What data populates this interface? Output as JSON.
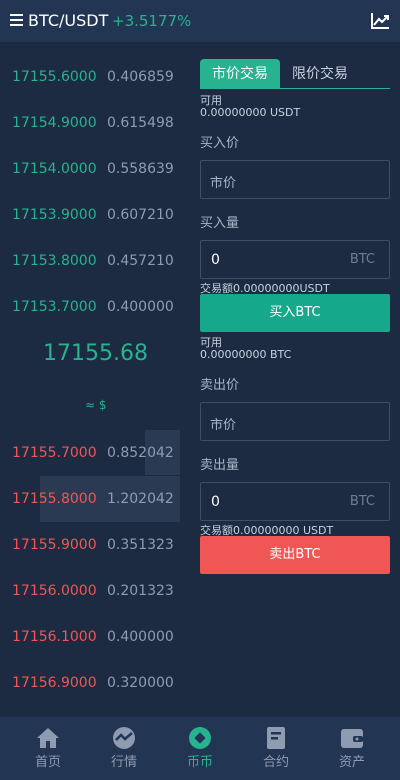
{
  "header": {
    "pair": "BTC/USDT",
    "change": "+3.5177%",
    "menu_icon": "menu-icon",
    "chart_icon": "line-chart-icon"
  },
  "orderbook": {
    "asks_green": [
      {
        "price": "17155.6000",
        "qty": "0.406859"
      },
      {
        "price": "17154.9000",
        "qty": "0.615498"
      },
      {
        "price": "17154.0000",
        "qty": "0.558639"
      },
      {
        "price": "17153.9000",
        "qty": "0.607210"
      },
      {
        "price": "17153.8000",
        "qty": "0.457210"
      },
      {
        "price": "17153.7000",
        "qty": "0.400000"
      }
    ],
    "last_price": "17155.68",
    "approx": "≈ $",
    "bids_red": [
      {
        "price": "17155.7000",
        "qty": "0.852042"
      },
      {
        "price": "17155.8000",
        "qty": "1.202042"
      },
      {
        "price": "17155.9000",
        "qty": "0.351323"
      },
      {
        "price": "17156.0000",
        "qty": "0.201323"
      },
      {
        "price": "17156.1000",
        "qty": "0.400000"
      },
      {
        "price": "17156.9000",
        "qty": "0.320000"
      }
    ]
  },
  "trade": {
    "tab_market": "市价交易",
    "tab_limit": "限价交易",
    "buy": {
      "available_label": "可用",
      "available_value": "0.00000000  USDT",
      "price_label": "买入价",
      "price_placeholder": "市价",
      "amount_label": "买入量",
      "amount_value": "0",
      "amount_unit": "BTC",
      "total": "交易额0.00000000USDT",
      "button": "买入BTC"
    },
    "sell": {
      "available_label": "可用",
      "available_value": "0.00000000  BTC",
      "price_label": "卖出价",
      "price_placeholder": "市价",
      "amount_label": "卖出量",
      "amount_value": "0",
      "amount_unit": "BTC",
      "total": "交易额0.00000000 USDT",
      "button": "卖出BTC"
    }
  },
  "tabbar": {
    "items": [
      {
        "label": "首页",
        "icon": "home-icon"
      },
      {
        "label": "行情",
        "icon": "market-icon"
      },
      {
        "label": "币币",
        "icon": "coin-icon"
      },
      {
        "label": "合约",
        "icon": "contract-icon"
      },
      {
        "label": "资产",
        "icon": "wallet-icon"
      }
    ],
    "active": "币币"
  },
  "colors": {
    "background": "#1c2b41",
    "accent_green": "#27b38f",
    "red": "#f25555",
    "buy_button": "#15a88a",
    "sell_button": "#f05655"
  }
}
